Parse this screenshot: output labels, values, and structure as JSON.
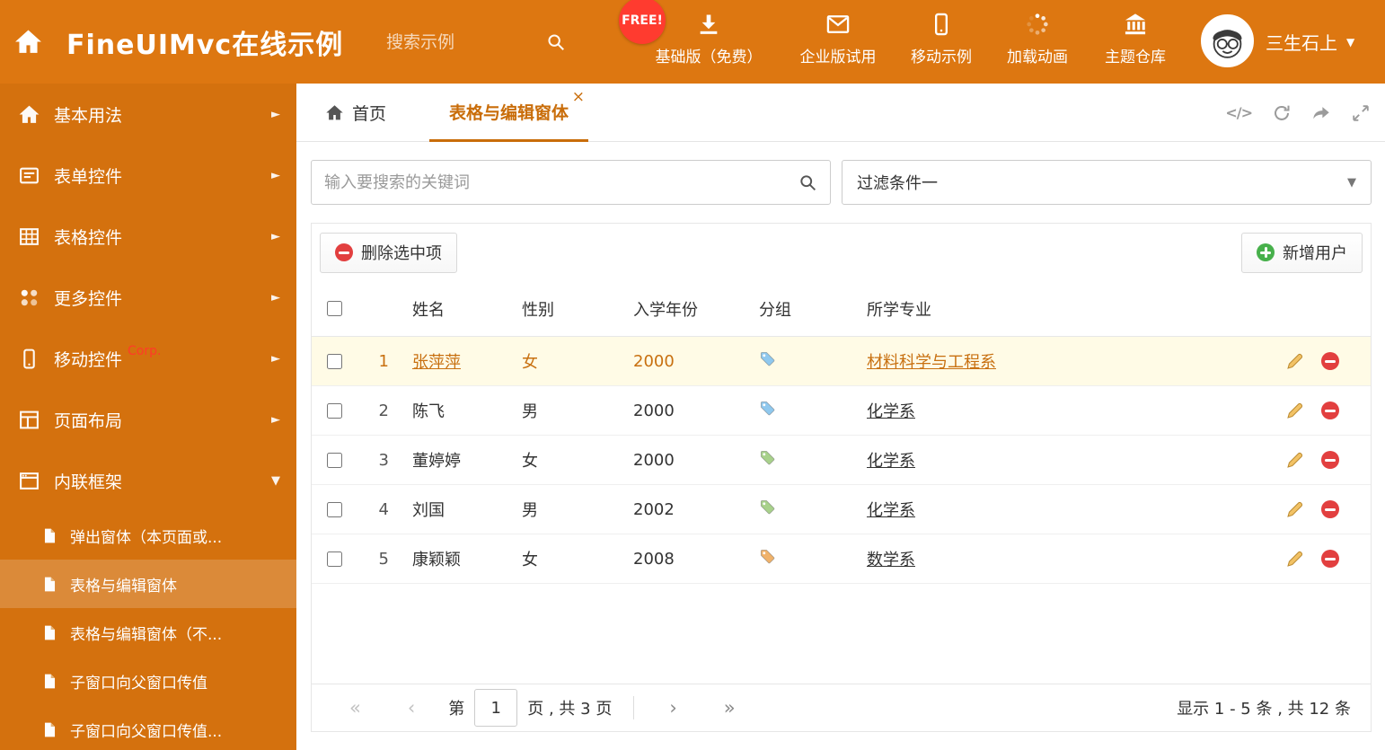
{
  "header": {
    "app_title": "FineUIMvc在线示例",
    "search_placeholder": "搜索示例",
    "free_badge": "FREE!",
    "nav_items": [
      {
        "label": "基础版（免费）"
      },
      {
        "label": "企业版试用"
      },
      {
        "label": "移动示例"
      },
      {
        "label": "加载动画"
      },
      {
        "label": "主题仓库"
      }
    ],
    "user_name": "三生石上"
  },
  "sidebar": {
    "items": [
      {
        "label": "基本用法"
      },
      {
        "label": "表单控件"
      },
      {
        "label": "表格控件"
      },
      {
        "label": "更多控件"
      },
      {
        "label": "移动控件",
        "badge": "Corp."
      },
      {
        "label": "页面布局"
      },
      {
        "label": "内联框架"
      }
    ],
    "subitems": [
      {
        "label": "弹出窗体（本页面或..."
      },
      {
        "label": "表格与编辑窗体"
      },
      {
        "label": "表格与编辑窗体（不..."
      },
      {
        "label": "子窗口向父窗口传值"
      },
      {
        "label": "子窗口向父窗口传值..."
      }
    ]
  },
  "tabbar": {
    "home_tab": "首页",
    "active_tab": "表格与编辑窗体"
  },
  "filter": {
    "search_placeholder": "输入要搜索的关键词",
    "dropdown_value": "过滤条件一"
  },
  "toolbar": {
    "delete_button": "删除选中项",
    "add_button": "新增用户"
  },
  "table": {
    "columns": [
      "姓名",
      "性别",
      "入学年份",
      "分组",
      "所学专业"
    ],
    "rows": [
      {
        "num": "1",
        "name": "张萍萍",
        "gender": "女",
        "year": "2000",
        "tag": "blue",
        "major": "材料科学与工程系"
      },
      {
        "num": "2",
        "name": "陈飞",
        "gender": "男",
        "year": "2000",
        "tag": "blue",
        "major": "化学系"
      },
      {
        "num": "3",
        "name": "董婷婷",
        "gender": "女",
        "year": "2000",
        "tag": "green",
        "major": "化学系"
      },
      {
        "num": "4",
        "name": "刘国",
        "gender": "男",
        "year": "2002",
        "tag": "green",
        "major": "化学系"
      },
      {
        "num": "5",
        "name": "康颖颖",
        "gender": "女",
        "year": "2008",
        "tag": "orange",
        "major": "数学系"
      }
    ]
  },
  "pagination": {
    "page_label_prefix": "第",
    "page_input_value": "1",
    "page_label_suffix": "页 , 共 3 页",
    "summary": "显示 1 - 5 条 , 共 12 条"
  },
  "icons": {
    "chevron_right": "►",
    "chevron_down": "▼",
    "caret_down": "▼",
    "close": "×",
    "code": "</>",
    "pager_first": "«",
    "pager_prev": "‹",
    "pager_next": "›",
    "pager_last": "»"
  },
  "colors": {
    "header_bg": "#dd7711",
    "sidebar_bg": "#d4710e",
    "accent": "#c96d0a",
    "selected_row_bg": "#fffbe6",
    "selected_row_text": "#c87010",
    "free_badge_bg": "#ff3b2f",
    "delete_icon": "#e23f3f",
    "add_icon": "#47b04b",
    "tag_blue": "#8fc8ee",
    "tag_green": "#a8d18b",
    "tag_orange": "#f0b26a"
  }
}
